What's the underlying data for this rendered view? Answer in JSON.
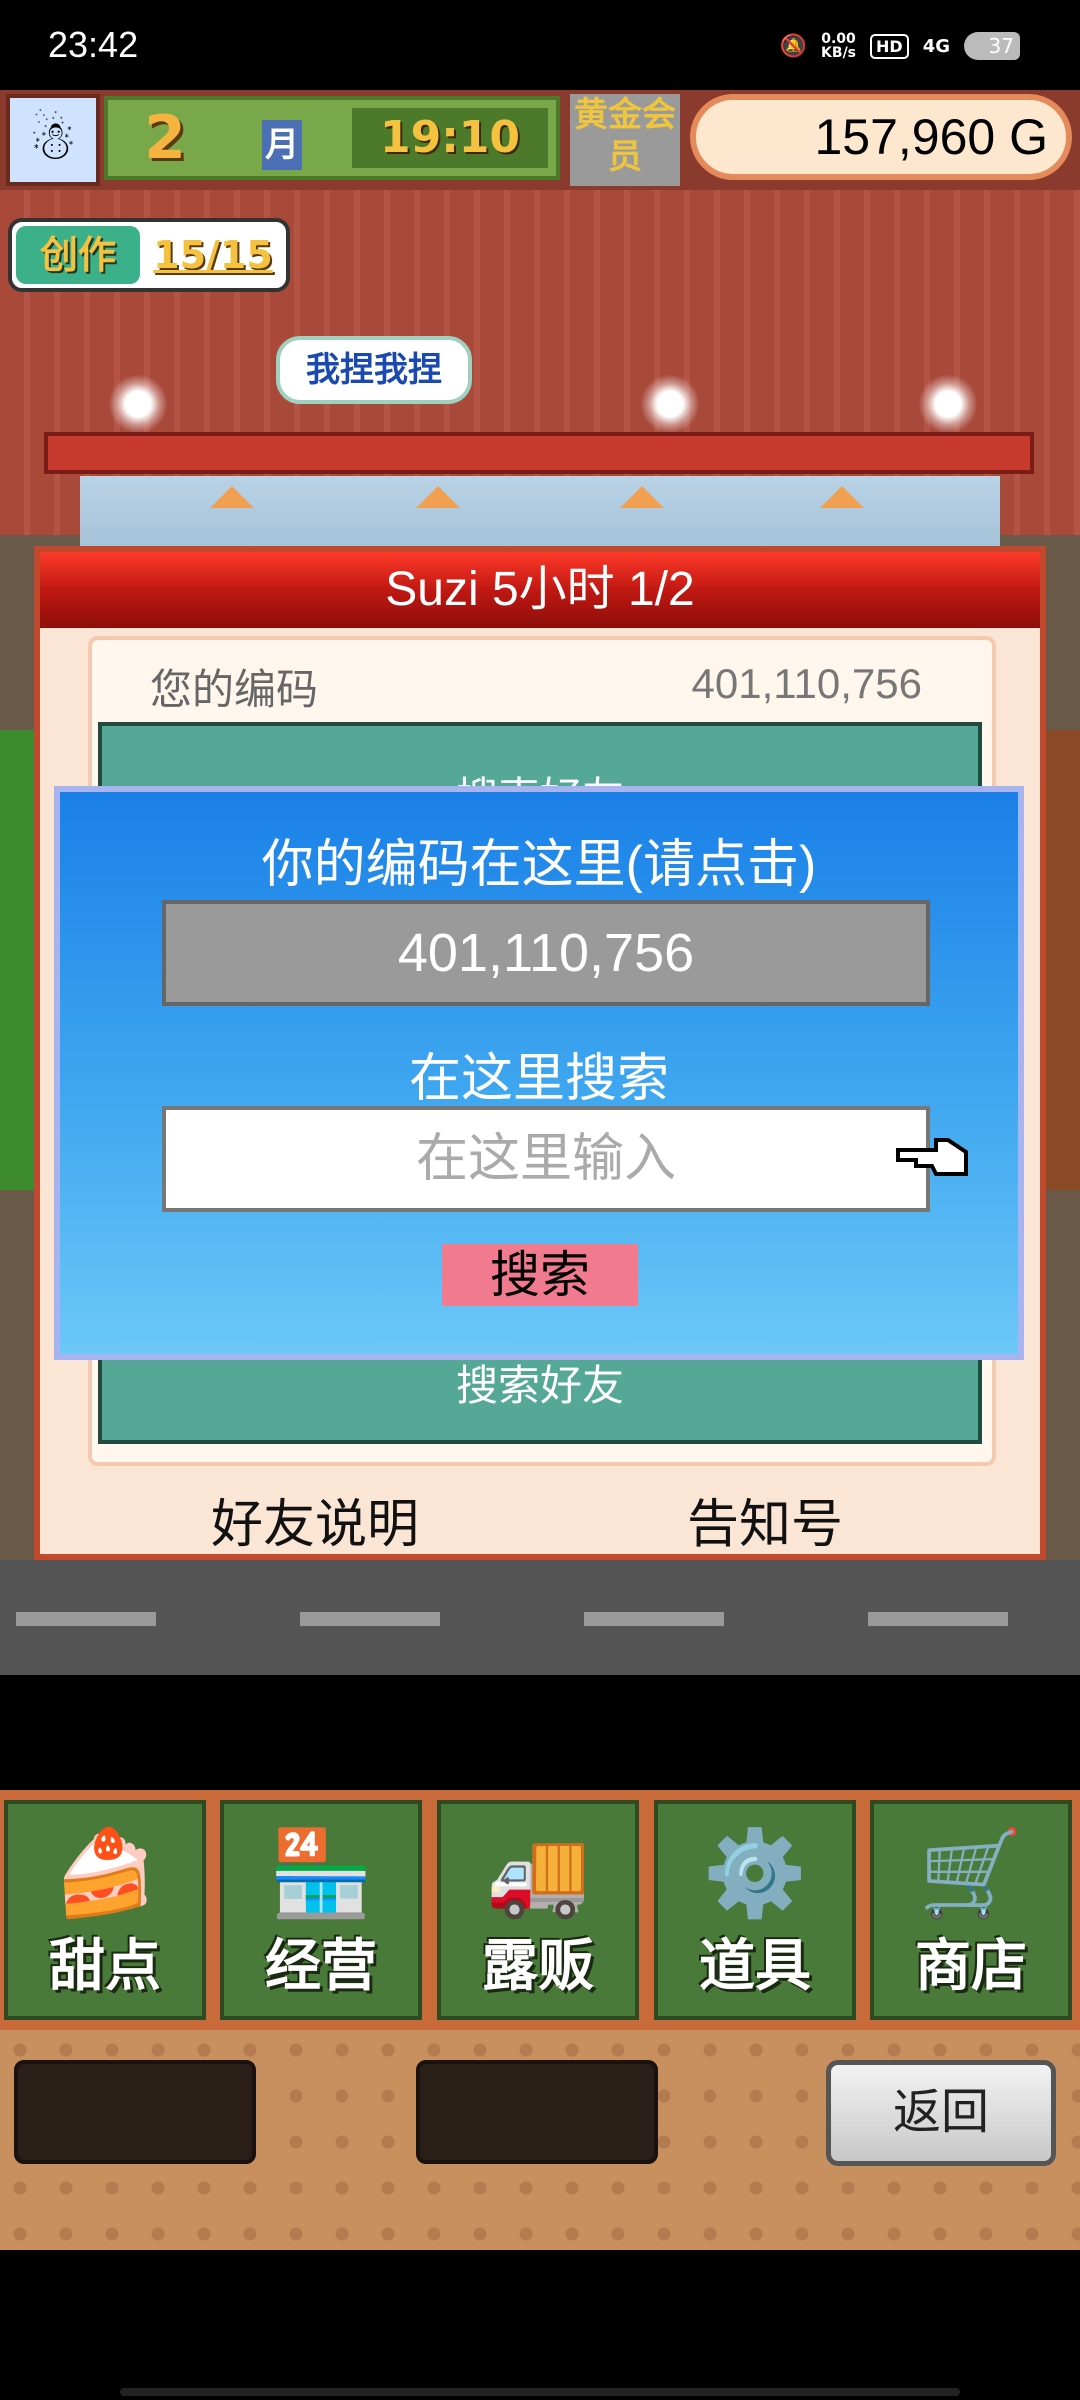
{
  "status_bar": {
    "time": "23:42",
    "net_speed": "0.00",
    "net_unit": "KB/s",
    "hd": "HD",
    "network": "4G",
    "battery": "37"
  },
  "hud": {
    "month_number": "2",
    "month_label": "月",
    "time": "19:10",
    "member_badge": "黄金会员",
    "gold": "157,960 G",
    "craft_label": "创作",
    "craft_count": "15/15",
    "speech_bubble": "我捏我捏"
  },
  "friend_panel": {
    "title": "Suzi  5小时 1/2",
    "your_code_label": "您的编码",
    "your_code_value": "401,110,756",
    "search_friend_label": "搜索好友",
    "friend_help": "好友说明",
    "notice_number": "告知号"
  },
  "dialog": {
    "title": "你的编码在这里(请点击)",
    "code": "401,110,756",
    "search_label": "在这里搜索",
    "input_placeholder": "在这里输入",
    "search_button": "搜索"
  },
  "nav": {
    "items": [
      {
        "label": "甜点",
        "icon": "cake-icon"
      },
      {
        "label": "经营",
        "icon": "shop-icon"
      },
      {
        "label": "露贩",
        "icon": "food-truck-icon"
      },
      {
        "label": "道具",
        "icon": "items-icon"
      },
      {
        "label": "商店",
        "icon": "shopping-cart-icon"
      }
    ],
    "back_button": "返回"
  }
}
